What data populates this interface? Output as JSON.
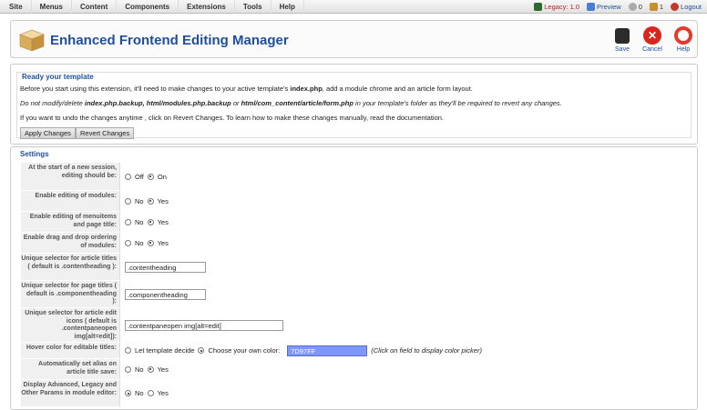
{
  "menu": [
    "Site",
    "Menus",
    "Content",
    "Components",
    "Extensions",
    "Tools",
    "Help"
  ],
  "status": {
    "legacy": "Legacy: 1.0",
    "preview": "Preview",
    "messages": "0",
    "users": "1",
    "logout": "Logout"
  },
  "header": {
    "title": "Enhanced Frontend Editing Manager",
    "save": "Save",
    "cancel": "Cancel",
    "help": "Help"
  },
  "ready": {
    "legend": "Ready your template",
    "line1_a": "Before you start using this extension, it'll need to make changes to your active template's ",
    "line1_b": "index.php",
    "line1_c": ", add a module chrome and an article form layout.",
    "line2_a": "Do not modify/delete ",
    "line2_b": "index.php.backup, html/modules.php.backup",
    "line2_c": " or ",
    "line2_d": "html/com_content/article/form.php",
    "line2_e": " in your template's folder as they'll be required to revert any changes.",
    "line3": "If you want to undo the changes anytime , click on Revert Changes. To learn how to make these changes manually, read the documentation.",
    "apply": "Apply Changes",
    "revert": "Revert Changes"
  },
  "settings": {
    "legend": "Settings",
    "rows": [
      {
        "label": "At the start of a new session, editing should be:",
        "type": "radio",
        "options": [
          "Off",
          "On"
        ],
        "selected": 1
      },
      {
        "label": "Enable editing of modules:",
        "type": "radio",
        "options": [
          "No",
          "Yes"
        ],
        "selected": 1
      },
      {
        "label": "Enable editing of menuitems and page title:",
        "type": "radio",
        "options": [
          "No",
          "Yes"
        ],
        "selected": 1
      },
      {
        "label": "Enable drag and drop ordering of modules:",
        "type": "radio",
        "options": [
          "No",
          "Yes"
        ],
        "selected": 1
      },
      {
        "label": "Unique selector for article titles ( default is .contentheading ):",
        "type": "text",
        "value": ".contentheading"
      },
      {
        "label": "Unique selector for page titles ( default is .componentheading ):",
        "type": "text",
        "value": ".componentheading"
      },
      {
        "label": "Unique selector for article edit icons ( default is .contentpaneopen img[alt=edit]):",
        "type": "text",
        "value": ".contentpaneopen img[alt=edit]"
      },
      {
        "label": "Hover color for editable titles:",
        "type": "color",
        "options": [
          "Let template decide",
          "Choose your own color:"
        ],
        "selected": 1,
        "value": "7D97FF",
        "hint": "(Click on field to display color picker)"
      },
      {
        "label": "Automatically set alias on article title save:",
        "type": "radio",
        "options": [
          "No",
          "Yes"
        ],
        "selected": 1
      },
      {
        "label": "Display Advanced, Legacy and Other Params in module editor:",
        "type": "radio",
        "options": [
          "No",
          "Yes"
        ],
        "selected": 0
      }
    ]
  },
  "colors": {
    "accent": "#1e4f9e",
    "hover": "#7D97FF"
  }
}
